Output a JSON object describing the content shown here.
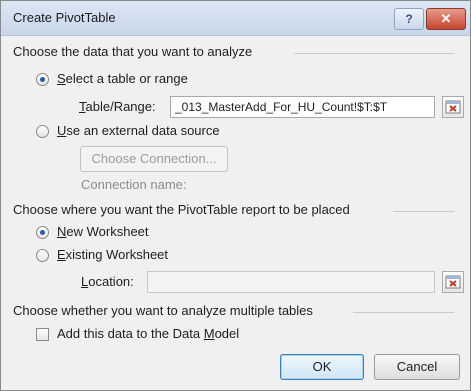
{
  "window": {
    "title": "Create PivotTable",
    "help_glyph": "?",
    "close_glyph": "✕"
  },
  "data_section": {
    "header": "Choose the data that you want to analyze",
    "select_table_option": {
      "prefix": "",
      "accel": "S",
      "rest": "elect a table or range",
      "selected": true
    },
    "table_range": {
      "accel": "T",
      "rest": "able/Range:",
      "value": "_013_MasterAdd_For_HU_Count!$T:$T"
    },
    "external_option": {
      "accel": "U",
      "rest": "se an external data source",
      "selected": false
    },
    "choose_connection_label": "Choose Connection...",
    "connection_name_label": "Connection name:"
  },
  "placement_section": {
    "header": "Choose where you want the PivotTable report to be placed",
    "new_worksheet": {
      "accel": "N",
      "rest": "ew Worksheet",
      "selected": true
    },
    "existing_worksheet": {
      "accel": "E",
      "rest": "xisting Worksheet",
      "selected": false
    },
    "location": {
      "accel": "L",
      "rest": "ocation:",
      "value": ""
    }
  },
  "multiple_tables_section": {
    "header": "Choose whether you want to analyze multiple tables",
    "data_model_checkbox": {
      "before": "Add this data to the Data ",
      "accel": "M",
      "rest": "odel",
      "checked": false
    }
  },
  "buttons": {
    "ok": "OK",
    "cancel": "Cancel"
  },
  "colors": {
    "titlebar": "#c8d6ea",
    "close_button": "#c6452e",
    "radio_dot": "#2a5aa8",
    "range_icon": "#c0392b"
  },
  "icons": {
    "help": "help-icon",
    "close": "close-icon",
    "range_selector": "collapse-dialog-icon"
  }
}
